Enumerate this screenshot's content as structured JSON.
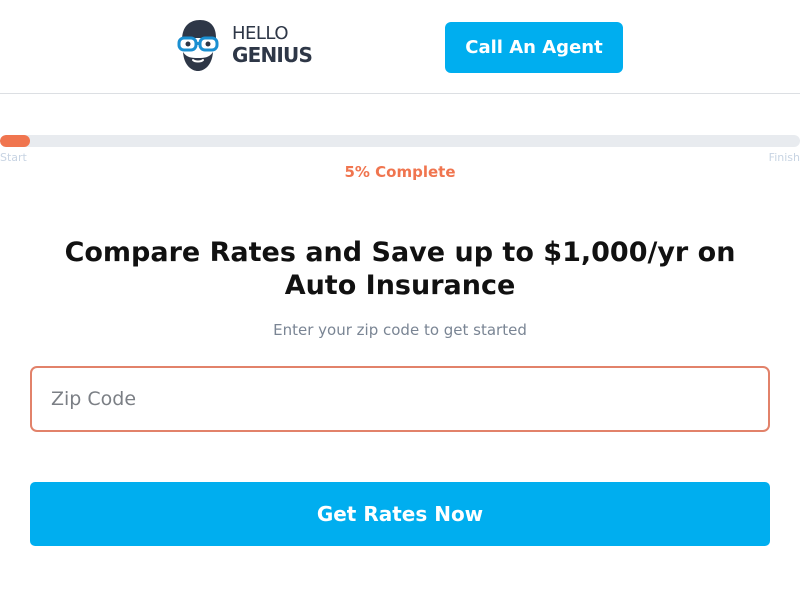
{
  "header": {
    "logo_line1": "HELLO",
    "logo_line2": "GENIUS",
    "call_button_label": "Call An Agent"
  },
  "progress": {
    "percent": 5,
    "start_label": "Start",
    "finish_label": "Finish",
    "complete_text": "5% Complete"
  },
  "main": {
    "headline": "Compare Rates and Save up to $1,000/yr on Auto Insurance",
    "subhead": "Enter your zip code to get started",
    "zip_placeholder": "Zip Code",
    "zip_value": "",
    "submit_label": "Get Rates Now"
  },
  "colors": {
    "brand_blue": "#00aeef",
    "accent_orange": "#f0754f",
    "logo_dark": "#2e3747"
  },
  "icons": {
    "logo": "genius-mascot-icon"
  }
}
